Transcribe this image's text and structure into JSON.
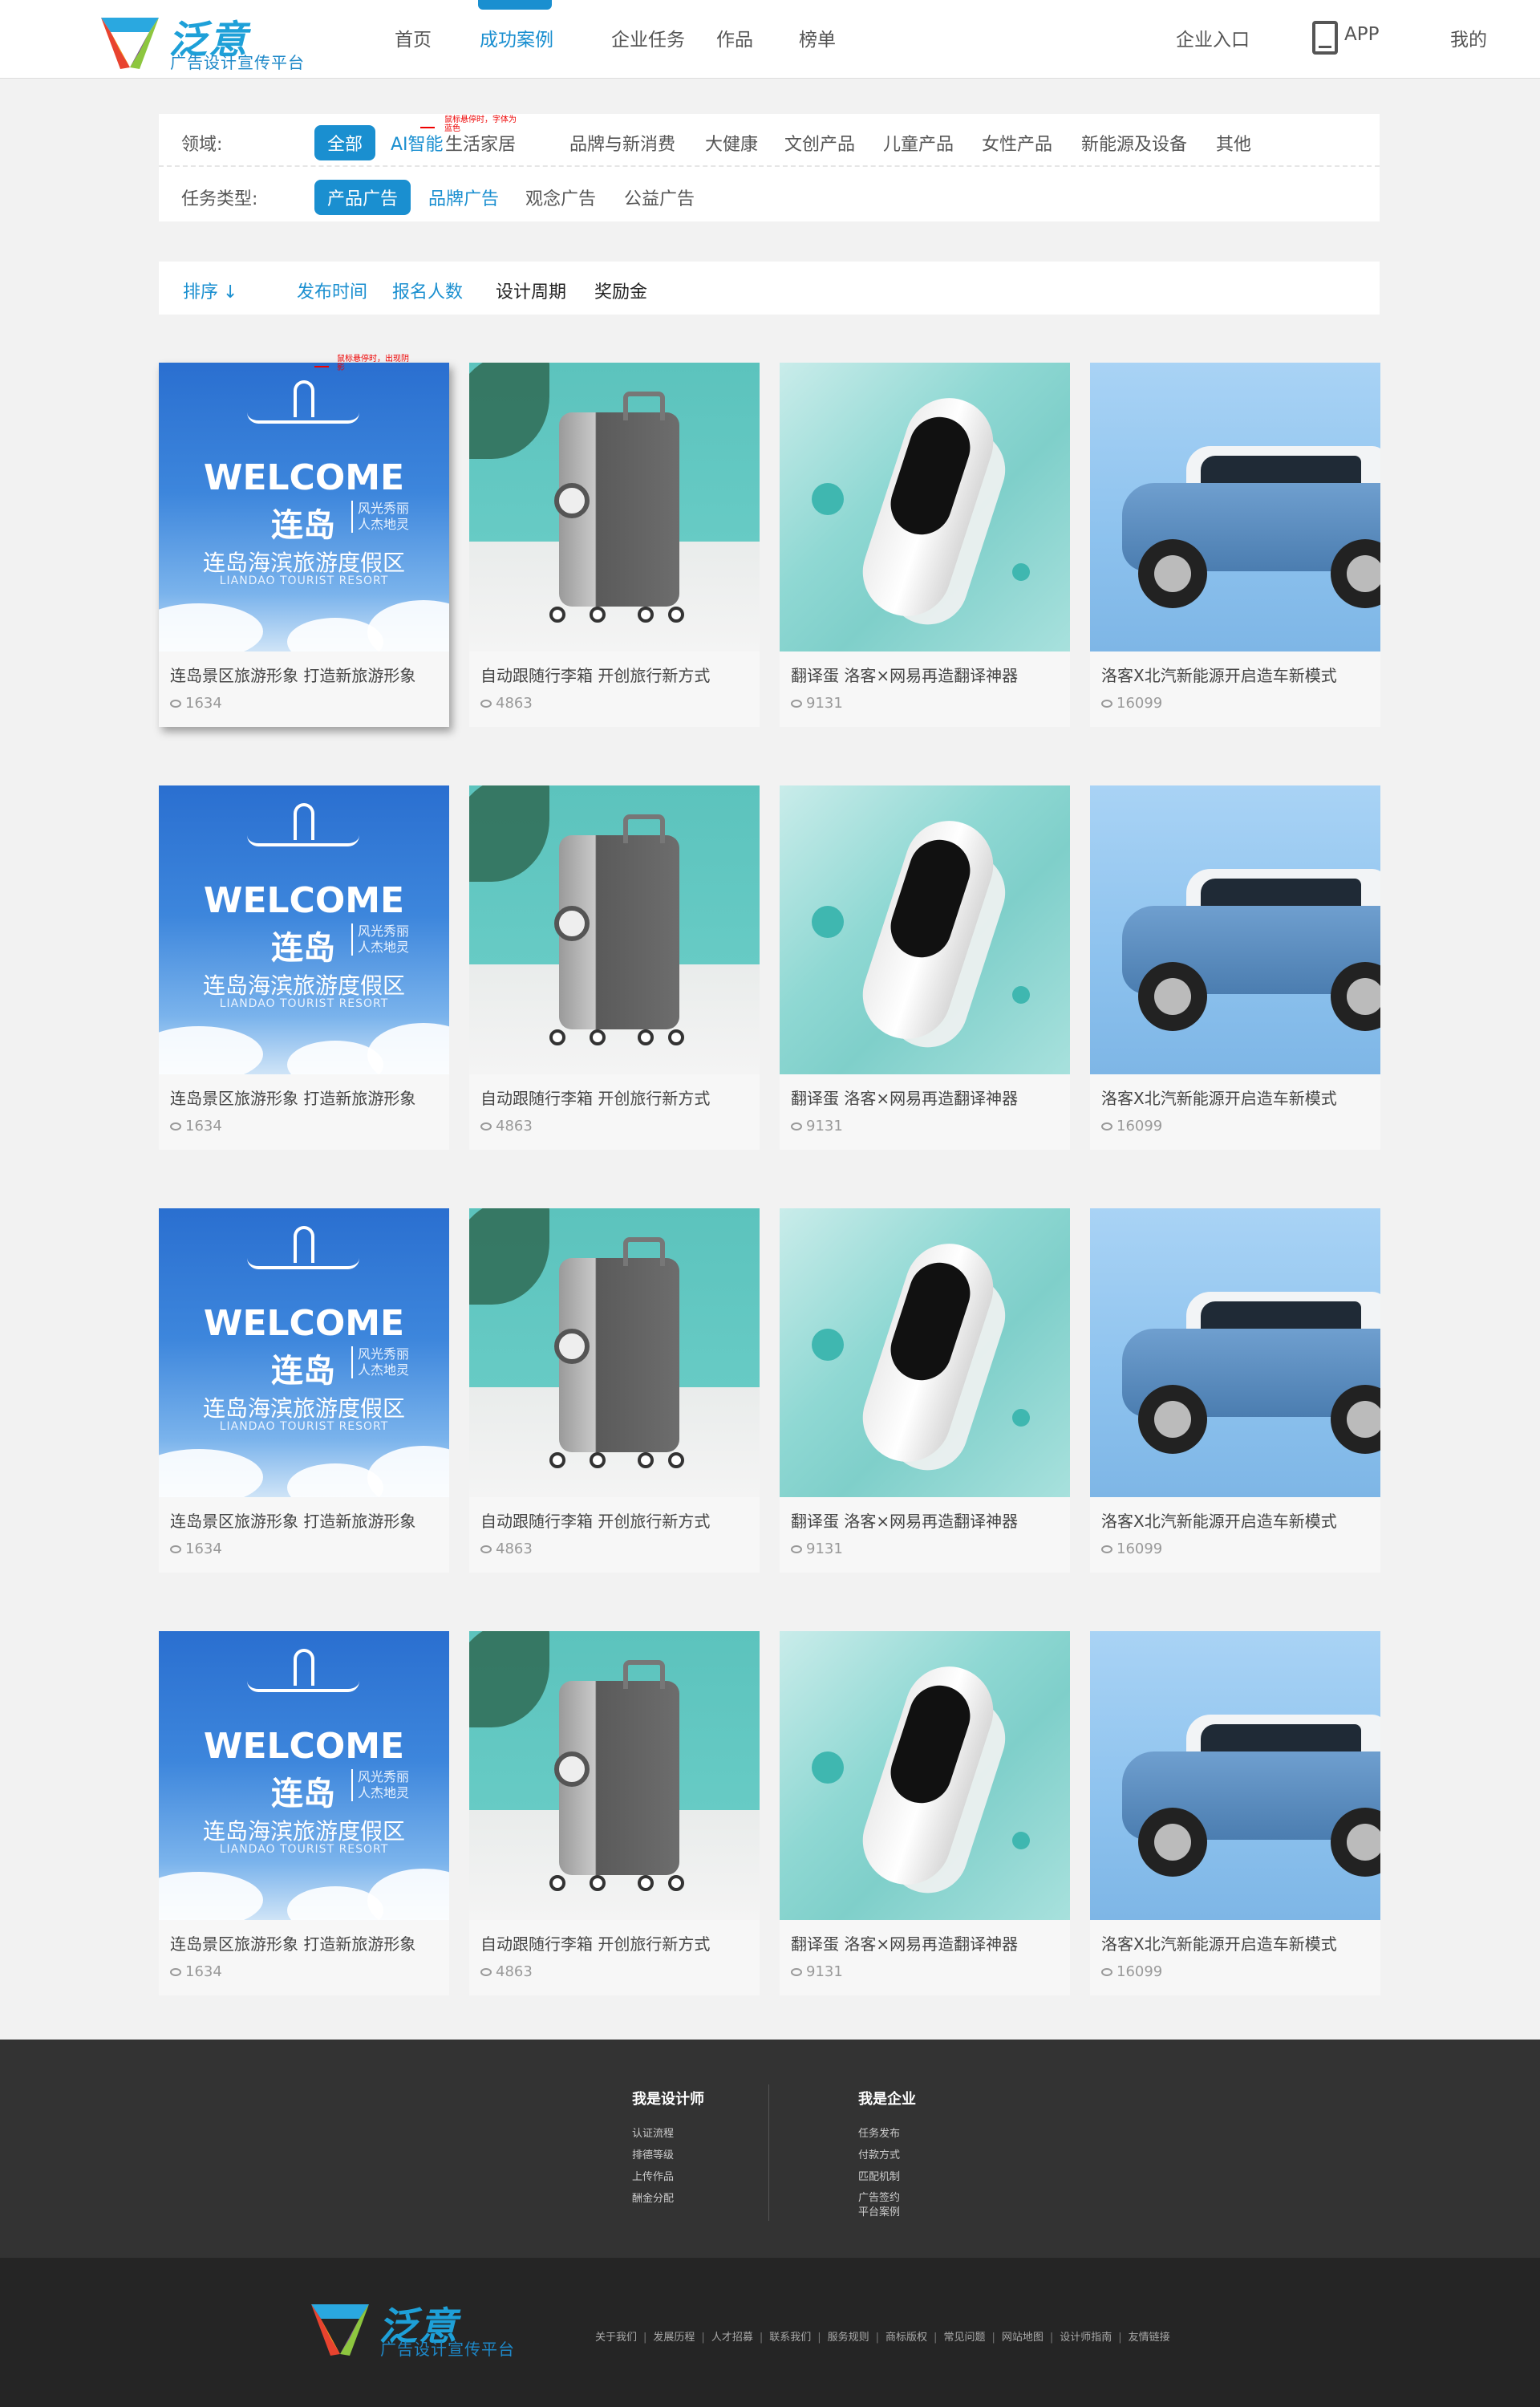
{
  "brand": {
    "name": "泛意",
    "slogan": "广告设计宣传平台"
  },
  "header": {
    "nav": [
      {
        "label": "首页"
      },
      {
        "label": "成功案例"
      },
      {
        "label": "企业任务"
      },
      {
        "label": "作品"
      },
      {
        "label": "榜单"
      }
    ],
    "enterprise_entry": "企业入口",
    "app_label": "APP",
    "mine_label": "我的"
  },
  "filters": {
    "domain_label": "领域:",
    "domain_options": [
      "全部",
      "AI智能",
      "生活家居",
      "品牌与新消费",
      "大健康",
      "文创产品",
      "儿童产品",
      "女性产品",
      "新能源及设备",
      "其他"
    ],
    "task_label": "任务类型:",
    "task_options": [
      "产品广告",
      "品牌广告",
      "观念广告",
      "公益广告"
    ],
    "hover_note": "鼠标悬停时，字体为蓝色"
  },
  "sort": {
    "label": "排序",
    "options": [
      "发布时间",
      "报名人数",
      "设计周期",
      "奖励金"
    ],
    "card_hover_note": "鼠标悬停时，出现阴影"
  },
  "cards": [
    {
      "title": "连岛景区旅游形象 打造新旅游形象",
      "views": "1634",
      "kind": "sky"
    },
    {
      "title": "自动跟随行李箱 开创旅行新方式",
      "views": "4863",
      "kind": "luggage"
    },
    {
      "title": "翻译蛋 洛客×网易再造翻译神器",
      "views": "9131",
      "kind": "translator"
    },
    {
      "title": "洛客X北汽新能源开启造车新模式",
      "views": "16099",
      "kind": "car"
    }
  ],
  "thumb_text": {
    "welcome": "WELCOME",
    "island": "连岛",
    "tagline": "风光秀丽 人杰地灵",
    "resort_cn": "连岛海滨旅游度假区",
    "resort_en": "LIANDAO TOURIST RESORT"
  },
  "footer": {
    "designer": {
      "title": "我是设计师",
      "links": [
        "认证流程",
        "排德等级",
        "上传作品",
        "酬金分配"
      ]
    },
    "enterprise": {
      "title": "我是企业",
      "links": [
        "任务发布",
        "付款方式",
        "匹配机制",
        "广告签约 平台案例"
      ]
    },
    "bottom_links": [
      "关于我们",
      "发展历程",
      "人才招募",
      "联系我们",
      "服务规则",
      "商标版权",
      "常见问题",
      "网站地图",
      "设计师指南",
      "友情链接"
    ]
  },
  "colors": {
    "accent": "#1a8fd0",
    "footer_top": "#333333",
    "footer_bottom": "#252525"
  }
}
